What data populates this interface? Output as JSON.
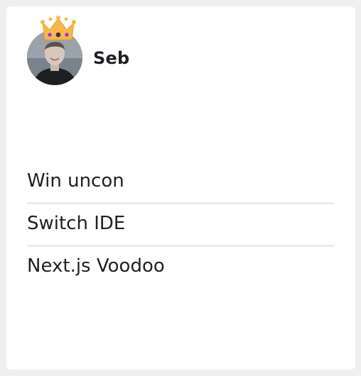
{
  "user": {
    "name": "Seb",
    "avatar_icon": "user-photo",
    "badge_icon": "crown-icon"
  },
  "todos": [
    {
      "label": "Win uncon"
    },
    {
      "label": "Switch IDE"
    },
    {
      "label": "Next.js Voodoo"
    }
  ],
  "colors": {
    "page_background": "#efefef",
    "card_background": "#ffffff",
    "text": "#1f2024",
    "divider": "#ececec",
    "crown_gold": "#f6b84a",
    "crown_gem": "#a02ee0"
  }
}
